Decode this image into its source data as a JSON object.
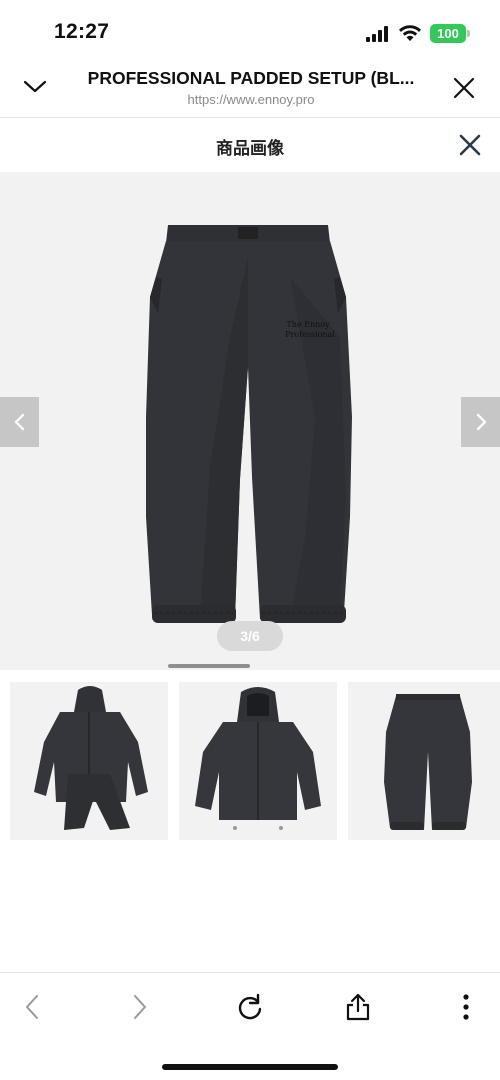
{
  "status_bar": {
    "time": "12:27",
    "battery": "100",
    "battery_color": "#34c759"
  },
  "browser": {
    "title": "PROFESSIONAL PADDED SETUP (BL...",
    "url": "https://www.ennoy.pro",
    "icons": [
      "chevron-down-icon",
      "close-icon"
    ]
  },
  "page": {
    "header_label": "商品画像",
    "close_icon_color": "#2b3a4a"
  },
  "gallery": {
    "counter": "3/6",
    "main_image": "padded-pants-black",
    "main_image_text": [
      "The Ennoy",
      "Professional"
    ],
    "thumbnails": [
      {
        "name": "setup-jacket-and-pants"
      },
      {
        "name": "hooded-jacket"
      },
      {
        "name": "padded-pants"
      }
    ]
  },
  "toolbar": {
    "items": [
      "back-icon",
      "forward-icon",
      "reload-icon",
      "share-icon",
      "more-icon"
    ]
  }
}
